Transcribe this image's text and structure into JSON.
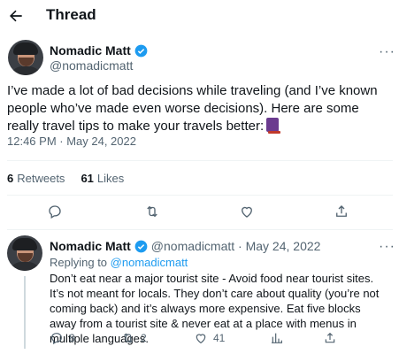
{
  "header": {
    "title": "Thread",
    "back_icon": "arrow-left-icon"
  },
  "main_tweet": {
    "display_name": "Nomadic Matt",
    "handle": "@nomadicmatt",
    "text": "I’ve made a lot of bad decisions while traveling (and I’ve known people who’ve made even worse decisions). Here are some really travel tips to make your travels better:",
    "emoji": "book-emoji",
    "timestamp": "12:46 PM · May 24, 2022",
    "retweets_count": "6",
    "retweets_label": "Retweets",
    "likes_count": "61",
    "likes_label": "Likes",
    "more": "···"
  },
  "reply_tweet": {
    "display_name": "Nomadic Matt",
    "handle_date": "@nomadicmatt · May 24, 2022",
    "replying_to_prefix": "Replying to",
    "replying_to_handle": "@nomadicmatt",
    "text": "Don’t eat near a major tourist site - Avoid food near tourist sites. It’s not meant for locals. They don’t care about quality (you’re not coming back) and it’s always more expensive. Eat five blocks away from a tourist site & never eat at a place with menus in multiple languages.",
    "replies": "8",
    "retweets": "2",
    "likes": "41",
    "more": "···"
  },
  "colors": {
    "accent": "#1d9bf0",
    "secondary_text": "#536471",
    "divider": "#eff3f4"
  }
}
